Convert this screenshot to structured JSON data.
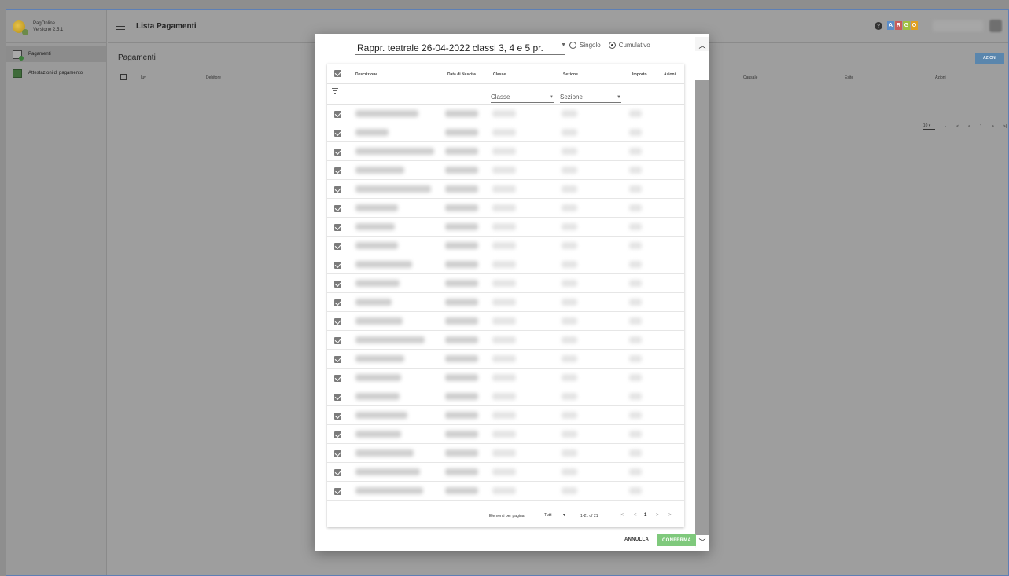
{
  "sidebar": {
    "app_name": "PagOnline",
    "version": "Versione 2.5.1",
    "items": [
      {
        "label": "Pagamenti",
        "icon": "payments-icon"
      },
      {
        "label": "Attestazioni di pagamento",
        "icon": "receipt-icon"
      }
    ]
  },
  "header": {
    "title": "Lista Pagamenti",
    "logo_letters": [
      "A",
      "R",
      "G",
      "O"
    ],
    "logo_colors": [
      "#5b8dc9",
      "#c95b5b",
      "#9fbf3f",
      "#e0a020"
    ]
  },
  "main": {
    "title": "Pagamenti",
    "actions_label": "AZIONI",
    "columns": [
      "Iuv",
      "Debitore",
      "Causale",
      "Esito",
      "Azioni"
    ],
    "pager": {
      "per_page": "10",
      "separator": "-",
      "page": "1"
    }
  },
  "dialog": {
    "event_select_value": "Rappr. teatrale 26-04-2022 classi 3, 4 e 5 pr.",
    "mode_options": [
      "Singolo",
      "Cumulativo"
    ],
    "mode_selected": "Cumulativo",
    "table": {
      "columns": [
        "Descrizione",
        "Data di Nascita",
        "Classe",
        "Sezione",
        "Importo",
        "Azioni"
      ],
      "filter_classe_placeholder": "Classe",
      "filter_sezione_placeholder": "Sezione",
      "rows_selected": 21
    },
    "pager": {
      "label": "Elementi per pagina",
      "per_page": "Tutti",
      "range": "1-21 of 21",
      "page": "1"
    },
    "cancel_label": "ANNULLA",
    "confirm_label": "CONFERMA"
  }
}
